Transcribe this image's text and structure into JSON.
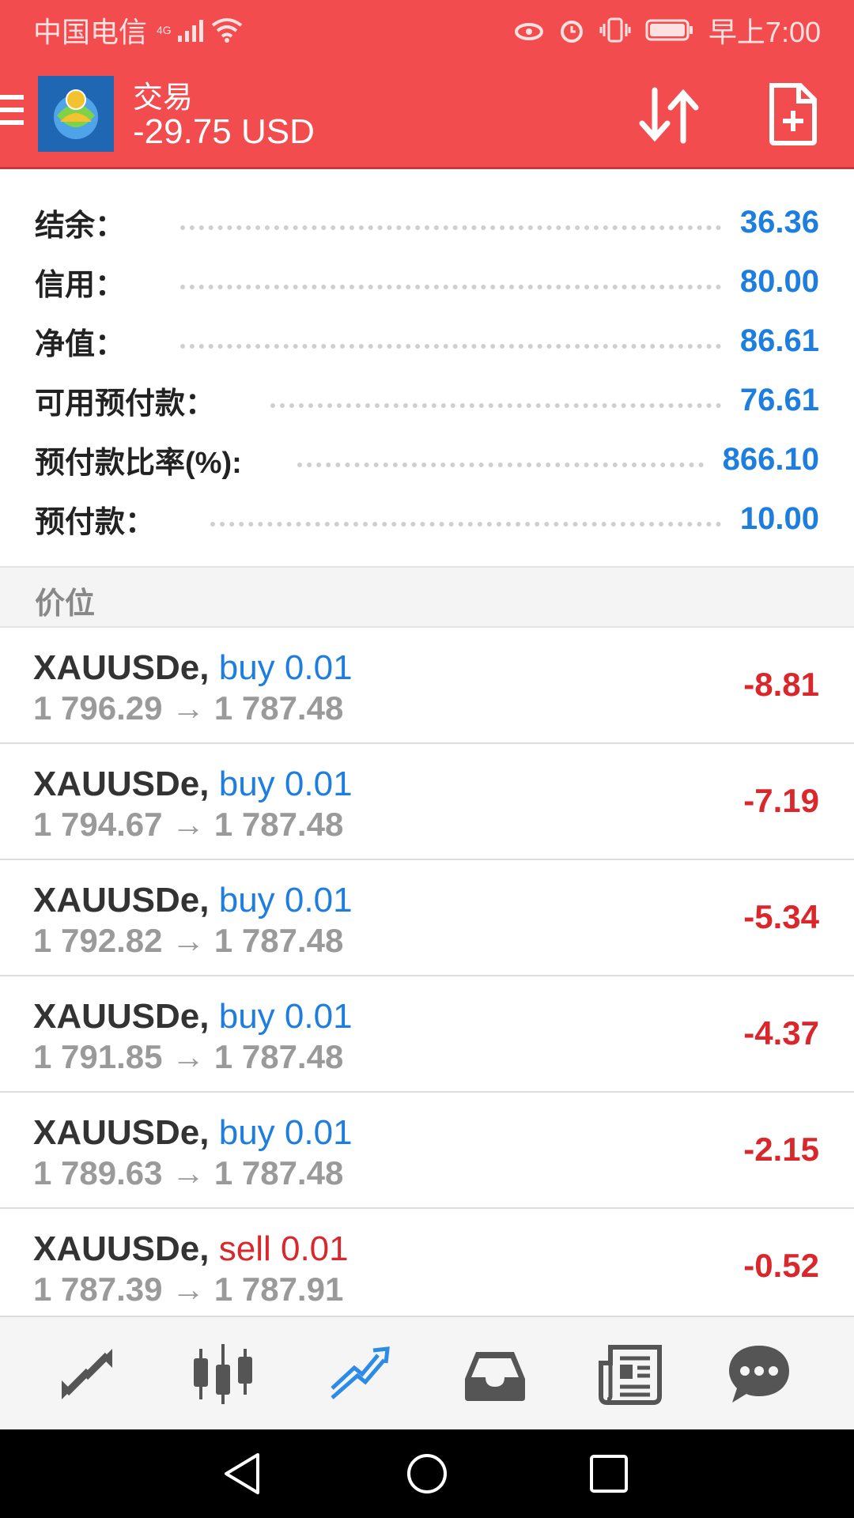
{
  "status_bar": {
    "carrier": "中国电信",
    "network": "4G",
    "time": "早上7:00"
  },
  "app_bar": {
    "title": "交易",
    "profit": "-29.75 USD"
  },
  "account": [
    {
      "label": "结余：",
      "value": "36.36"
    },
    {
      "label": "信用：",
      "value": "80.00"
    },
    {
      "label": "净值：",
      "value": "86.61"
    },
    {
      "label": "可用预付款：",
      "value": "76.61"
    },
    {
      "label": "预付款比率(%):",
      "value": "866.10"
    },
    {
      "label": "预付款：",
      "value": "10.00"
    }
  ],
  "section_header": "价位",
  "positions": [
    {
      "symbol": "XAUUSDe,",
      "direction": "buy 0.01",
      "prices": "1 796.29 → 1 787.48",
      "profit": "-8.81"
    },
    {
      "symbol": "XAUUSDe,",
      "direction": "buy 0.01",
      "prices": "1 794.67 → 1 787.48",
      "profit": "-7.19"
    },
    {
      "symbol": "XAUUSDe,",
      "direction": "buy 0.01",
      "prices": "1 792.82 → 1 787.48",
      "profit": "-5.34"
    },
    {
      "symbol": "XAUUSDe,",
      "direction": "buy 0.01",
      "prices": "1 791.85 → 1 787.48",
      "profit": "-4.37"
    },
    {
      "symbol": "XAUUSDe,",
      "direction": "buy 0.01",
      "prices": "1 789.63 → 1 787.48",
      "profit": "-2.15"
    },
    {
      "symbol": "XAUUSDe,",
      "direction": "sell 0.01",
      "prices": "1 787.39 → 1 787.91",
      "profit": "-0.52"
    }
  ],
  "bottom_nav": [
    {
      "icon": "quotes-icon"
    },
    {
      "icon": "chart-icon"
    },
    {
      "icon": "trade-icon",
      "active": true
    },
    {
      "icon": "history-icon"
    },
    {
      "icon": "news-icon"
    },
    {
      "icon": "chat-icon"
    }
  ],
  "colors": {
    "accent": "#f34c4f",
    "value_blue": "#1e7ee0",
    "loss_red": "#d9272c",
    "active_nav": "#2d8be8"
  }
}
